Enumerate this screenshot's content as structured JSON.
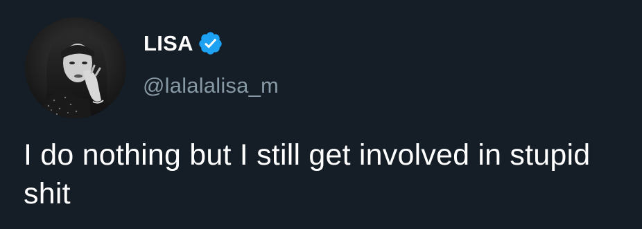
{
  "tweet": {
    "author": {
      "display_name": "LISA",
      "handle": "@lalalalisa_m",
      "verified": true,
      "verified_icon": "verified-badge-icon",
      "avatar": "profile-avatar"
    },
    "text": "I do nothing but I still get involved in stupid shit"
  },
  "colors": {
    "background": "#151d27",
    "text": "#ffffff",
    "handle": "#8899a6",
    "verified": "#1da1f2"
  }
}
